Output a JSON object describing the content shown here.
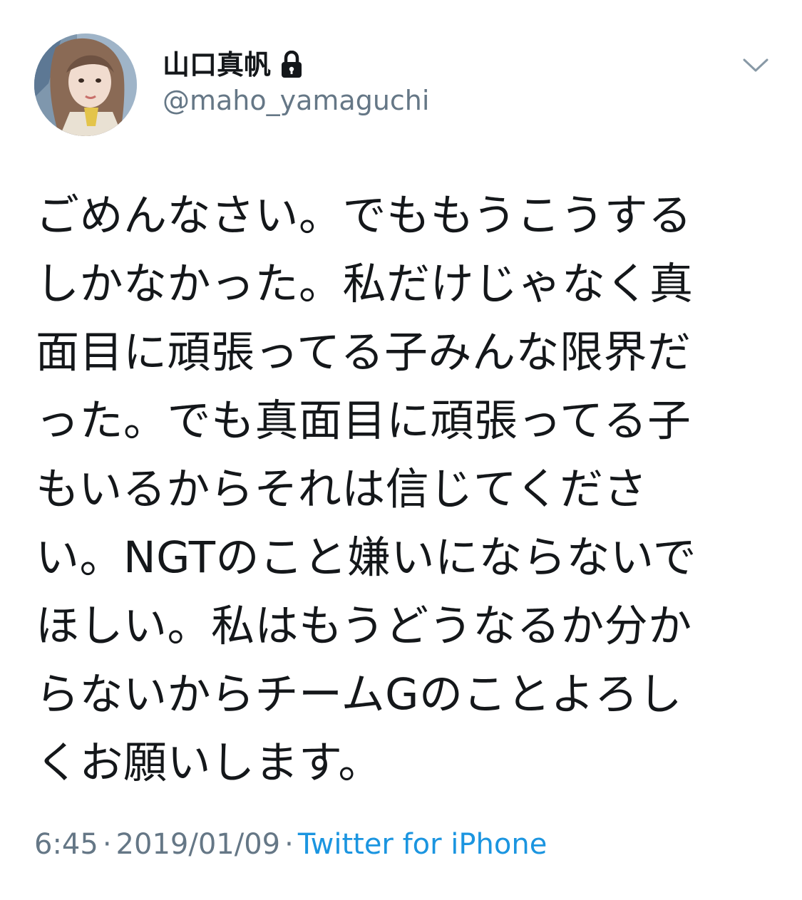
{
  "tweet": {
    "author": {
      "display_name": "山口真帆",
      "handle": "@maho_yamaguchi",
      "protected_icon": "lock-icon",
      "avatar": "avatar-photo"
    },
    "menu_icon": "chevron-down-icon",
    "text_lines": [
      "ごめんなさい。でももうこうする",
      "しかなかった。私だけじゃなく真",
      "面目に頑張ってる子みんな限界だ",
      "った。でも真面目に頑張ってる子",
      "もいるからそれは信じてくださ",
      "い。NGTのこと嫌いにならないで",
      "ほしい。私はもうどうなるか分か",
      "らないからチームGのことよろし",
      "くお願いします。"
    ],
    "meta": {
      "time": "6:45",
      "separator": "·",
      "date": "2019/01/09",
      "source": "Twitter for iPhone"
    }
  },
  "colors": {
    "text": "#14171a",
    "secondary": "#657786",
    "link": "#1b95e0",
    "background": "#ffffff"
  }
}
